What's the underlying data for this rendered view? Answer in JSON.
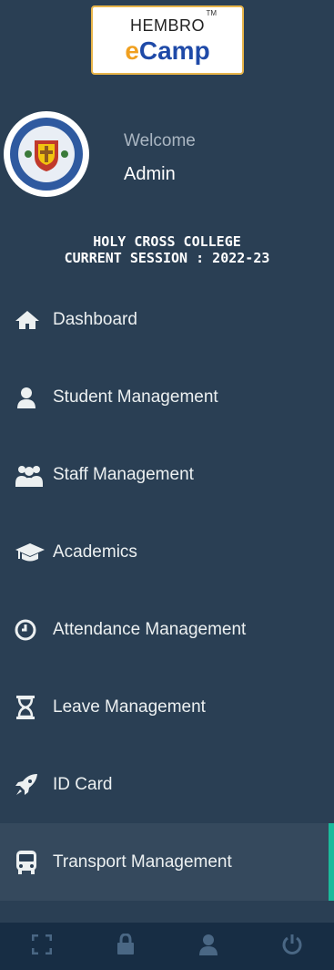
{
  "logo": {
    "top": "HEMBRO",
    "tm": "TM",
    "bottom_e": "e",
    "bottom": "Camp"
  },
  "profile": {
    "welcome": "Welcome",
    "name": "Admin"
  },
  "college": {
    "name": "HOLY CROSS COLLEGE",
    "session": "CURRENT SESSION : 2022-23"
  },
  "menu": [
    {
      "label": "Dashboard",
      "icon": "home-icon"
    },
    {
      "label": "Student Management",
      "icon": "user-icon"
    },
    {
      "label": "Staff Management",
      "icon": "users-icon"
    },
    {
      "label": "Academics",
      "icon": "graduation-cap-icon"
    },
    {
      "label": "Attendance Management",
      "icon": "clock-icon"
    },
    {
      "label": "Leave Management",
      "icon": "hourglass-icon"
    },
    {
      "label": "ID Card",
      "icon": "rocket-icon"
    },
    {
      "label": "Transport Management",
      "icon": "bus-icon",
      "active": true
    }
  ],
  "footer": [
    "fullscreen-icon",
    "lock-icon",
    "user-icon",
    "power-icon"
  ],
  "colors": {
    "sidebar": "#2a3f54",
    "active_bar": "#1abb9c",
    "footer": "#172d44"
  }
}
